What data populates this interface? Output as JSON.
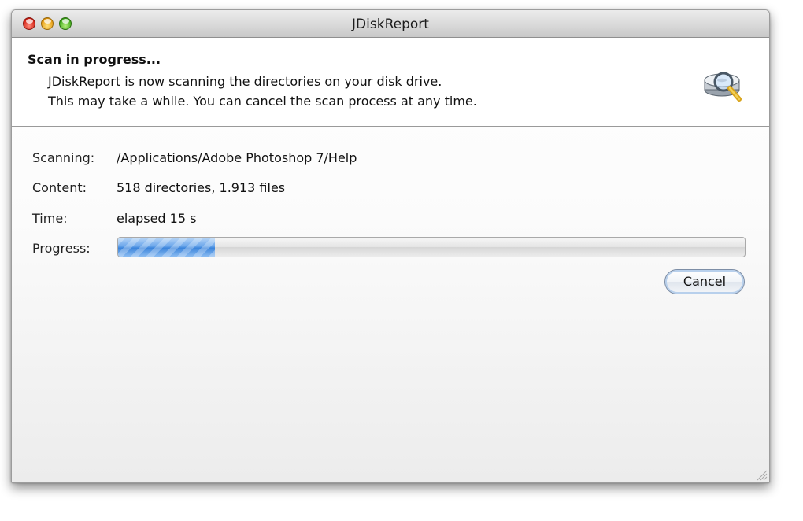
{
  "window": {
    "title": "JDiskReport",
    "controls": [
      "close",
      "minimize",
      "zoom"
    ]
  },
  "header": {
    "title": "Scan in progress...",
    "line1": "JDiskReport is now scanning the directories on your disk drive.",
    "line2": "This may take a while. You can cancel the scan process at any time.",
    "icon": "magnifier-disk-icon"
  },
  "details": {
    "scanning": {
      "label": "Scanning:",
      "value": "/Applications/Adobe Photoshop 7/Help"
    },
    "content": {
      "label": "Content:",
      "value": "518 directories, 1.913 files"
    },
    "time": {
      "label": "Time:",
      "value": "elapsed 15 s"
    },
    "progress": {
      "label": "Progress:",
      "fraction": 0.155
    }
  },
  "buttons": {
    "cancel": "Cancel"
  },
  "colors": {
    "progress_blue": "#3b84db",
    "close": "#d11f12",
    "minimize": "#e59a10",
    "zoom": "#3ca817"
  }
}
